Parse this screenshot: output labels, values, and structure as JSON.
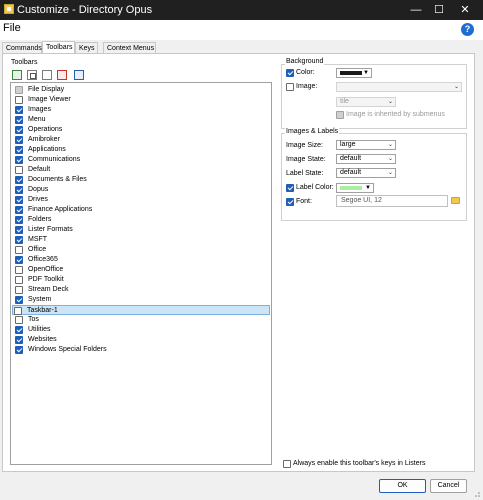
{
  "window": {
    "title": "Customize - Directory Opus",
    "minimize": "—",
    "maximize": "☐",
    "close": "✕"
  },
  "header": {
    "title": "File",
    "help": "?"
  },
  "tabs": [
    {
      "label": "Commands"
    },
    {
      "label": "Toolbars"
    },
    {
      "label": "Keys"
    },
    {
      "label": "Context Menus"
    }
  ],
  "toolbars_group": {
    "label": "Toolbars"
  },
  "toolbar_list": [
    {
      "label": "File Display",
      "state": "disabled"
    },
    {
      "label": "Image Viewer",
      "state": "off"
    },
    {
      "label": "Images",
      "state": "on"
    },
    {
      "label": "Menu",
      "state": "on"
    },
    {
      "label": "Operations",
      "state": "on"
    },
    {
      "label": "Amibroker",
      "state": "on"
    },
    {
      "label": "Applications",
      "state": "on"
    },
    {
      "label": "Communications",
      "state": "on"
    },
    {
      "label": "Default",
      "state": "off"
    },
    {
      "label": "Documents & Files",
      "state": "on"
    },
    {
      "label": "Dopus",
      "state": "on"
    },
    {
      "label": "Drives",
      "state": "on"
    },
    {
      "label": "Finance Applications",
      "state": "on"
    },
    {
      "label": "Folders",
      "state": "on"
    },
    {
      "label": "Lister Formats",
      "state": "on"
    },
    {
      "label": "MSFT",
      "state": "on"
    },
    {
      "label": "Office",
      "state": "off"
    },
    {
      "label": "Office365",
      "state": "on"
    },
    {
      "label": "OpenOffice",
      "state": "off"
    },
    {
      "label": "PDF Toolkit",
      "state": "off"
    },
    {
      "label": "Stream Deck",
      "state": "off"
    },
    {
      "label": "System",
      "state": "on"
    },
    {
      "label": "Taskbar-1",
      "state": "off",
      "selected": true
    },
    {
      "label": "Tos",
      "state": "off"
    },
    {
      "label": "Utilities",
      "state": "on"
    },
    {
      "label": "Websites",
      "state": "on"
    },
    {
      "label": "Windows Special Folders",
      "state": "on"
    }
  ],
  "background": {
    "title": "Background",
    "color_label": "Color:",
    "color_checked": true,
    "color_value": "#1a1a1a",
    "image_label": "Image:",
    "image_checked": false,
    "tile_value": "tile",
    "inherit_label": "Image is inherited by submenus"
  },
  "images_labels": {
    "title": "Images & Labels",
    "image_size_label": "Image Size:",
    "image_size_value": "large",
    "image_state_label": "Image State:",
    "image_state_value": "default",
    "label_state_label": "Label State:",
    "label_state_value": "default",
    "label_color_label": "Label Color:",
    "label_color_value": "#a8f0a0",
    "font_label": "Font:",
    "font_value": "Segoe UI, 12"
  },
  "footer": {
    "always_enable_label": "Always enable this toolbar's keys in Listers",
    "ok": "OK",
    "cancel": "Cancel"
  }
}
